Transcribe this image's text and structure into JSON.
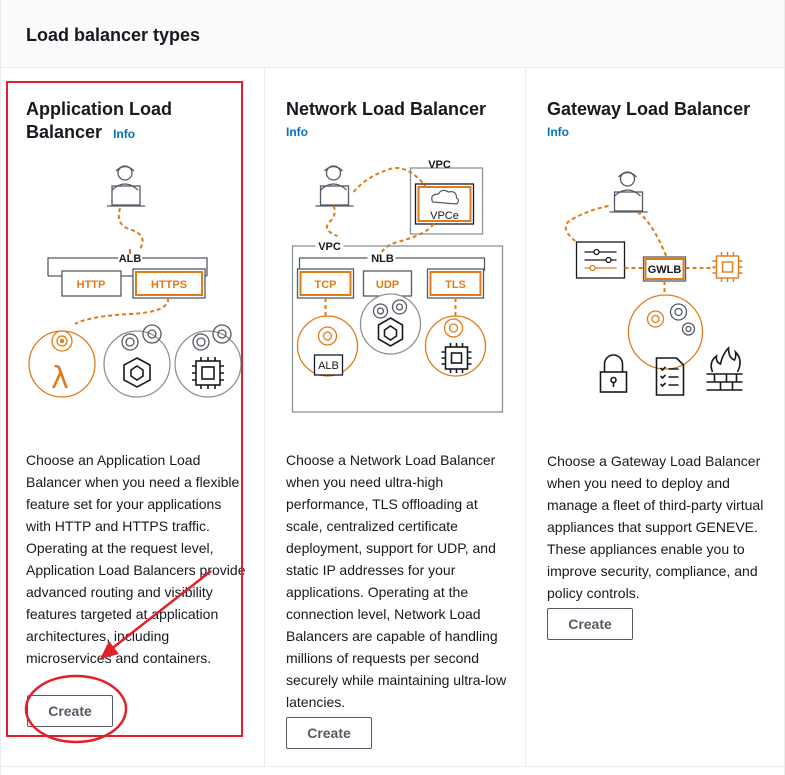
{
  "header": {
    "title": "Load balancer types"
  },
  "cards": [
    {
      "title_line1": "Application Load",
      "title_line2": "Balancer",
      "info": "Info",
      "description": "Choose an Application Load Balancer when you need a flexible feature set for your applications with HTTP and HTTPS traffic. Operating at the request level, Application Load Balancers provide advanced routing and visibility features targeted at application architectures, including microservices and containers.",
      "button": "Create",
      "diagram": {
        "group": "ALB",
        "listeners": [
          "HTTP",
          "HTTPS"
        ],
        "icons": [
          "person-laptop-icon",
          "lambda-icon",
          "container-icon",
          "chip-icon"
        ]
      }
    },
    {
      "title": "Network Load Balancer",
      "info": "Info",
      "description": "Choose a Network Load Balancer when you need ultra-high performance, TLS offloading at scale, centralized certificate deployment, support for UDP, and static IP addresses for your applications. Operating at the connection level, Network Load Balancers are capable of handling millions of requests per second securely while maintaining ultra-low latencies.",
      "button": "Create",
      "diagram": {
        "vpc_top": "VPC",
        "endpoint": "VPCe",
        "vpc": "VPC",
        "group": "NLB",
        "listeners": [
          "TCP",
          "UDP",
          "TLS"
        ],
        "target": "ALB"
      }
    },
    {
      "title": "Gateway Load Balancer",
      "info": "Info",
      "description": "Choose a Gateway Load Balancer when you need to deploy and manage a fleet of third-party virtual appliances that support GENEVE. These appliances enable you to improve security, compliance, and policy controls.",
      "button": "Create",
      "diagram": {
        "group": "GWLB",
        "icons": [
          "router-icon",
          "chip-icon",
          "lock-icon",
          "checklist-icon",
          "firewall-icon"
        ]
      }
    }
  ],
  "colors": {
    "accent_orange": "#e07b1a",
    "link": "#0073bb",
    "annotation_red": "#e0212a",
    "gray_line": "#545b64"
  }
}
